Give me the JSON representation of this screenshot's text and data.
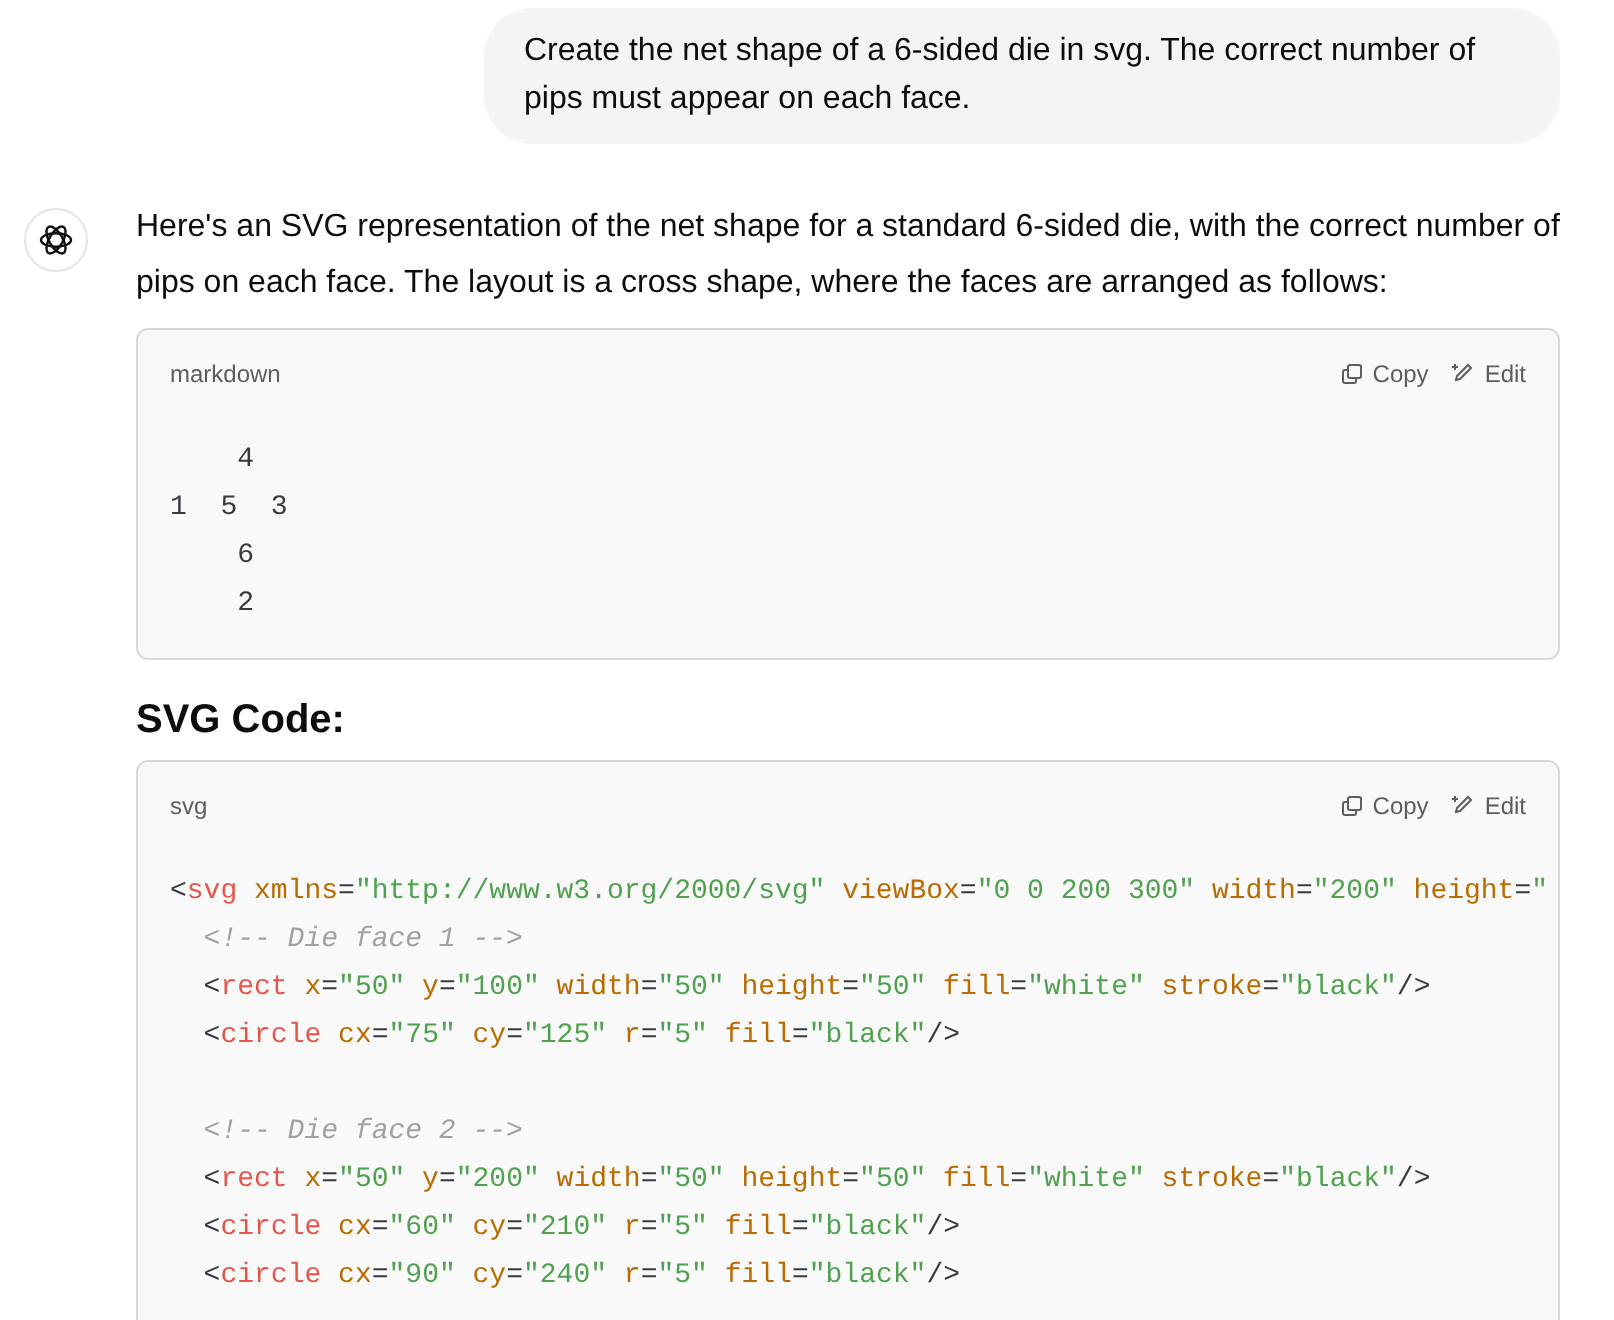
{
  "user_message": {
    "text": "Create the net shape of a 6-sided die in svg. The correct number of pips must appear on each face."
  },
  "assistant_message": {
    "intro": "Here's an SVG representation of the net shape for a standard 6-sided die, with the correct number of pips on each face. The layout is a cross shape, where the faces are arranged as follows:",
    "blocks": [
      {
        "kind": "code",
        "language": "markdown",
        "buttons": [
          "Copy",
          "Edit"
        ],
        "lines": [
          {
            "kind": "code",
            "tokens": [
              {
                "kind": "plain",
                "text": "    4"
              }
            ]
          },
          {
            "kind": "code",
            "tokens": [
              {
                "kind": "plain",
                "text": "1  5  3"
              }
            ]
          },
          {
            "kind": "code",
            "tokens": [
              {
                "kind": "plain",
                "text": "    6"
              }
            ]
          },
          {
            "kind": "code",
            "tokens": [
              {
                "kind": "plain",
                "text": "    2"
              }
            ]
          }
        ]
      },
      {
        "kind": "heading",
        "text": "SVG Code:"
      },
      {
        "kind": "code",
        "language": "svg",
        "buttons": [
          "Copy",
          "Edit"
        ],
        "lines": [
          {
            "kind": "code",
            "tokens": [
              {
                "kind": "punct",
                "text": "<"
              },
              {
                "kind": "tag",
                "text": "svg"
              },
              {
                "kind": "attr",
                "text": " xmlns"
              },
              {
                "kind": "punct",
                "text": "="
              },
              {
                "kind": "string",
                "text": "\"http://www.w3.org/2000/svg\""
              },
              {
                "kind": "attr",
                "text": " viewBox"
              },
              {
                "kind": "punct",
                "text": "="
              },
              {
                "kind": "string",
                "text": "\"0 0 200 300\""
              },
              {
                "kind": "attr",
                "text": " width"
              },
              {
                "kind": "punct",
                "text": "="
              },
              {
                "kind": "string",
                "text": "\"200\""
              },
              {
                "kind": "attr",
                "text": " height"
              },
              {
                "kind": "punct",
                "text": "="
              },
              {
                "kind": "string",
                "text": "\""
              }
            ]
          },
          {
            "kind": "code",
            "tokens": [
              {
                "kind": "comment",
                "text": "  <!-- Die face 1 -->"
              }
            ]
          },
          {
            "kind": "code",
            "tokens": [
              {
                "kind": "punct",
                "text": "  <"
              },
              {
                "kind": "tag",
                "text": "rect"
              },
              {
                "kind": "attr",
                "text": " x"
              },
              {
                "kind": "punct",
                "text": "="
              },
              {
                "kind": "string",
                "text": "\"50\""
              },
              {
                "kind": "attr",
                "text": " y"
              },
              {
                "kind": "punct",
                "text": "="
              },
              {
                "kind": "string",
                "text": "\"100\""
              },
              {
                "kind": "attr",
                "text": " width"
              },
              {
                "kind": "punct",
                "text": "="
              },
              {
                "kind": "string",
                "text": "\"50\""
              },
              {
                "kind": "attr",
                "text": " height"
              },
              {
                "kind": "punct",
                "text": "="
              },
              {
                "kind": "string",
                "text": "\"50\""
              },
              {
                "kind": "attr",
                "text": " fill"
              },
              {
                "kind": "punct",
                "text": "="
              },
              {
                "kind": "string",
                "text": "\"white\""
              },
              {
                "kind": "attr",
                "text": " stroke"
              },
              {
                "kind": "punct",
                "text": "="
              },
              {
                "kind": "string",
                "text": "\"black\""
              },
              {
                "kind": "punct",
                "text": "/>"
              }
            ]
          },
          {
            "kind": "code",
            "tokens": [
              {
                "kind": "punct",
                "text": "  <"
              },
              {
                "kind": "tag",
                "text": "circle"
              },
              {
                "kind": "attr",
                "text": " cx"
              },
              {
                "kind": "punct",
                "text": "="
              },
              {
                "kind": "string",
                "text": "\"75\""
              },
              {
                "kind": "attr",
                "text": " cy"
              },
              {
                "kind": "punct",
                "text": "="
              },
              {
                "kind": "string",
                "text": "\"125\""
              },
              {
                "kind": "attr",
                "text": " r"
              },
              {
                "kind": "punct",
                "text": "="
              },
              {
                "kind": "string",
                "text": "\"5\""
              },
              {
                "kind": "attr",
                "text": " fill"
              },
              {
                "kind": "punct",
                "text": "="
              },
              {
                "kind": "string",
                "text": "\"black\""
              },
              {
                "kind": "punct",
                "text": "/>"
              }
            ]
          },
          {
            "kind": "blank"
          },
          {
            "kind": "code",
            "tokens": [
              {
                "kind": "comment",
                "text": "  <!-- Die face 2 -->"
              }
            ]
          },
          {
            "kind": "code",
            "tokens": [
              {
                "kind": "punct",
                "text": "  <"
              },
              {
                "kind": "tag",
                "text": "rect"
              },
              {
                "kind": "attr",
                "text": " x"
              },
              {
                "kind": "punct",
                "text": "="
              },
              {
                "kind": "string",
                "text": "\"50\""
              },
              {
                "kind": "attr",
                "text": " y"
              },
              {
                "kind": "punct",
                "text": "="
              },
              {
                "kind": "string",
                "text": "\"200\""
              },
              {
                "kind": "attr",
                "text": " width"
              },
              {
                "kind": "punct",
                "text": "="
              },
              {
                "kind": "string",
                "text": "\"50\""
              },
              {
                "kind": "attr",
                "text": " height"
              },
              {
                "kind": "punct",
                "text": "="
              },
              {
                "kind": "string",
                "text": "\"50\""
              },
              {
                "kind": "attr",
                "text": " fill"
              },
              {
                "kind": "punct",
                "text": "="
              },
              {
                "kind": "string",
                "text": "\"white\""
              },
              {
                "kind": "attr",
                "text": " stroke"
              },
              {
                "kind": "punct",
                "text": "="
              },
              {
                "kind": "string",
                "text": "\"black\""
              },
              {
                "kind": "punct",
                "text": "/>"
              }
            ]
          },
          {
            "kind": "code",
            "tokens": [
              {
                "kind": "punct",
                "text": "  <"
              },
              {
                "kind": "tag",
                "text": "circle"
              },
              {
                "kind": "attr",
                "text": " cx"
              },
              {
                "kind": "punct",
                "text": "="
              },
              {
                "kind": "string",
                "text": "\"60\""
              },
              {
                "kind": "attr",
                "text": " cy"
              },
              {
                "kind": "punct",
                "text": "="
              },
              {
                "kind": "string",
                "text": "\"210\""
              },
              {
                "kind": "attr",
                "text": " r"
              },
              {
                "kind": "punct",
                "text": "="
              },
              {
                "kind": "string",
                "text": "\"5\""
              },
              {
                "kind": "attr",
                "text": " fill"
              },
              {
                "kind": "punct",
                "text": "="
              },
              {
                "kind": "string",
                "text": "\"black\""
              },
              {
                "kind": "punct",
                "text": "/>"
              }
            ]
          },
          {
            "kind": "code",
            "tokens": [
              {
                "kind": "punct",
                "text": "  <"
              },
              {
                "kind": "tag",
                "text": "circle"
              },
              {
                "kind": "attr",
                "text": " cx"
              },
              {
                "kind": "punct",
                "text": "="
              },
              {
                "kind": "string",
                "text": "\"90\""
              },
              {
                "kind": "attr",
                "text": " cy"
              },
              {
                "kind": "punct",
                "text": "="
              },
              {
                "kind": "string",
                "text": "\"240\""
              },
              {
                "kind": "attr",
                "text": " r"
              },
              {
                "kind": "punct",
                "text": "="
              },
              {
                "kind": "string",
                "text": "\"5\""
              },
              {
                "kind": "attr",
                "text": " fill"
              },
              {
                "kind": "punct",
                "text": "="
              },
              {
                "kind": "string",
                "text": "\"black\""
              },
              {
                "kind": "punct",
                "text": "/>"
              }
            ]
          }
        ]
      }
    ]
  }
}
